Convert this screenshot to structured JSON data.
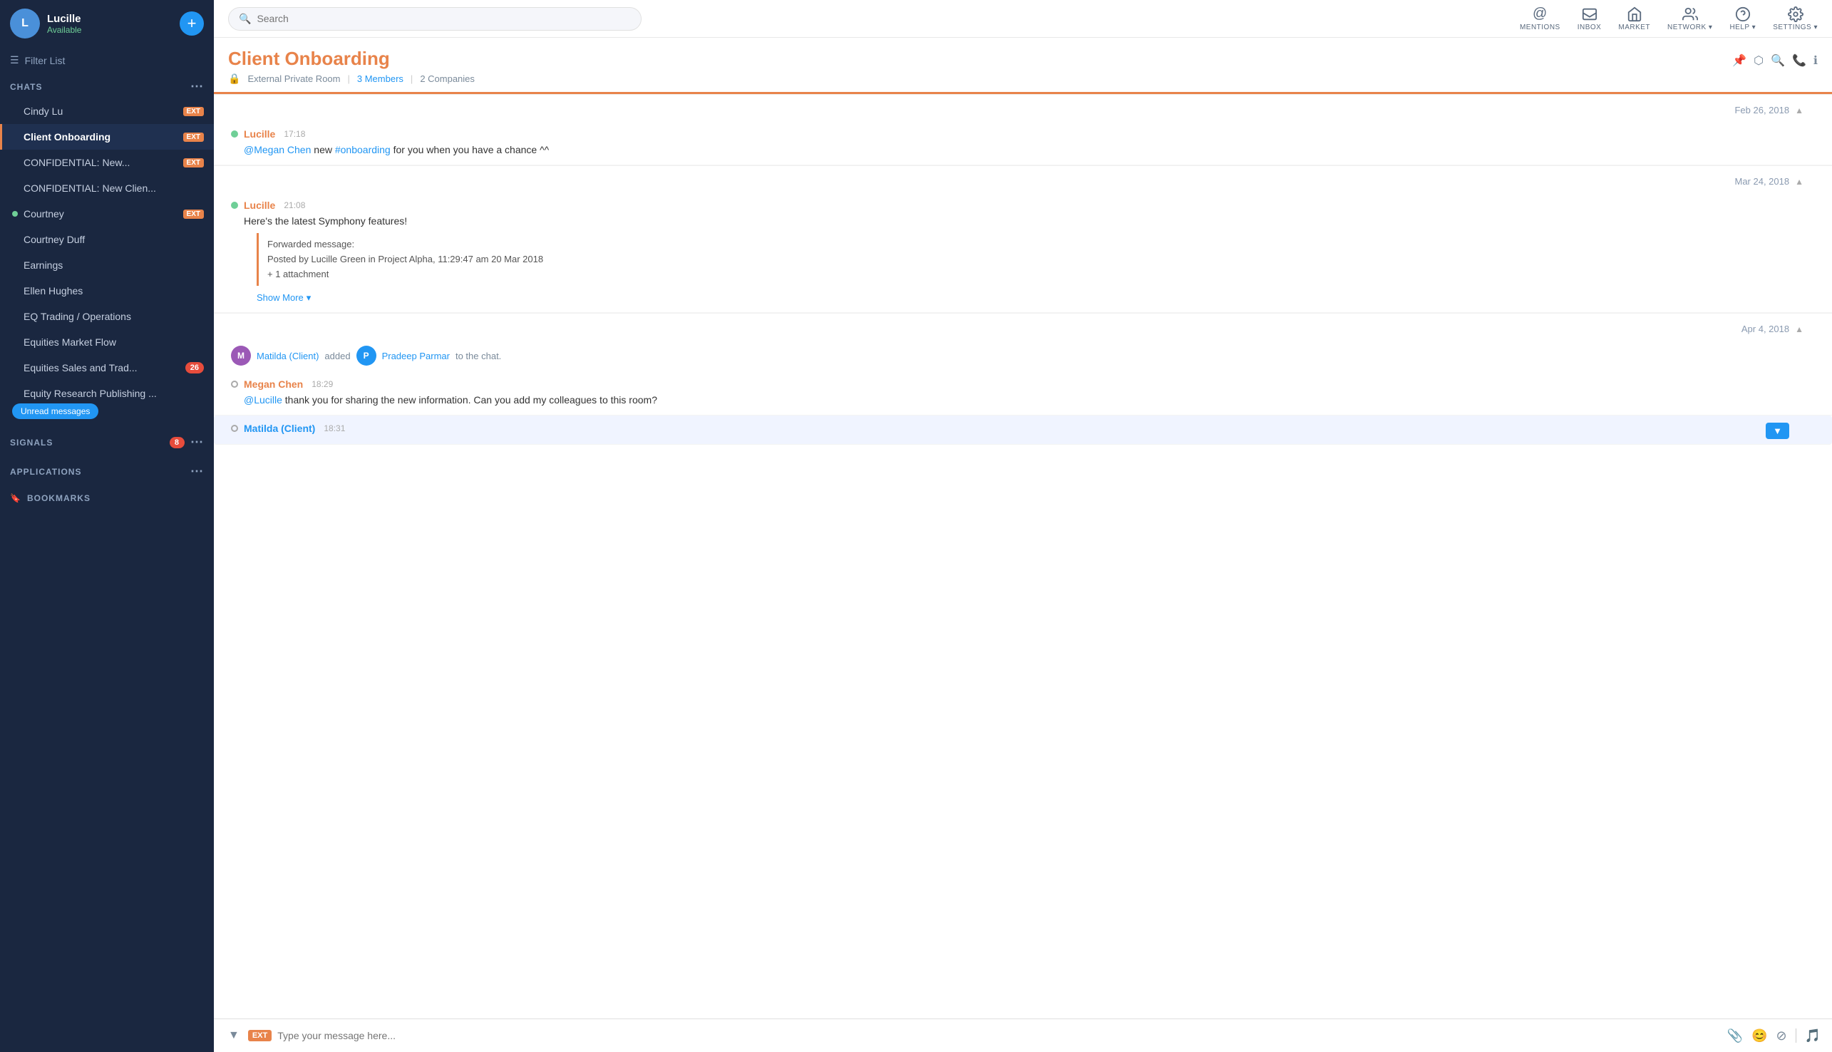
{
  "sidebar": {
    "user": {
      "name": "Lucille",
      "status": "Available",
      "initials": "L"
    },
    "add_button": "+",
    "filter_label": "Filter List",
    "sections": {
      "chats_label": "CHATS",
      "signals_label": "SIGNALS",
      "signals_badge": "8",
      "applications_label": "APPLICATIONS",
      "bookmarks_label": "BOOKMARKS"
    },
    "chats": [
      {
        "name": "Cindy Lu",
        "ext": true,
        "active": false,
        "status": "none",
        "unread": false
      },
      {
        "name": "Client Onboarding",
        "ext": true,
        "active": true,
        "status": "none",
        "unread": false
      },
      {
        "name": "CONFIDENTIAL: New...",
        "ext": true,
        "active": false,
        "status": "none",
        "unread": false
      },
      {
        "name": "CONFIDENTIAL: New Clien...",
        "ext": false,
        "active": false,
        "status": "none",
        "unread": false
      },
      {
        "name": "Courtney",
        "ext": true,
        "active": false,
        "status": "online",
        "unread": false
      },
      {
        "name": "Courtney Duff",
        "ext": false,
        "active": false,
        "status": "none",
        "unread": false
      },
      {
        "name": "Earnings",
        "ext": false,
        "active": false,
        "status": "none",
        "unread": false
      },
      {
        "name": "Ellen Hughes",
        "ext": false,
        "active": false,
        "status": "none",
        "unread": false
      },
      {
        "name": "EQ Trading / Operations",
        "ext": false,
        "active": false,
        "status": "none",
        "unread": false
      },
      {
        "name": "Equities Market Flow",
        "ext": false,
        "active": false,
        "status": "none",
        "unread": false
      },
      {
        "name": "Equities Sales and Trad...",
        "ext": false,
        "active": false,
        "status": "none",
        "badge": "26",
        "unread": false
      },
      {
        "name": "Equity Research Publishing ...",
        "ext": false,
        "active": false,
        "status": "none",
        "unread": true,
        "unread_label": "Unread messages"
      }
    ]
  },
  "topnav": {
    "search_placeholder": "Search",
    "icons": [
      {
        "id": "mentions",
        "label": "MENTIONS",
        "symbol": "@"
      },
      {
        "id": "inbox",
        "label": "INBOX",
        "symbol": "📥"
      },
      {
        "id": "market",
        "label": "MARKET",
        "symbol": "🏠"
      },
      {
        "id": "network",
        "label": "NETWORK ▾",
        "symbol": "👥"
      },
      {
        "id": "help",
        "label": "HELP ▾",
        "symbol": "?"
      },
      {
        "id": "settings",
        "label": "SETTINGS ▾",
        "symbol": "⚙"
      }
    ],
    "header_actions": [
      {
        "id": "pin",
        "symbol": "📌"
      },
      {
        "id": "popup",
        "symbol": "⬡"
      }
    ],
    "chat_actions": [
      {
        "id": "search-chat",
        "symbol": "🔍"
      },
      {
        "id": "call",
        "symbol": "📞"
      },
      {
        "id": "info",
        "symbol": "ℹ"
      }
    ]
  },
  "chat": {
    "title": "Client Onboarding",
    "room_type": "External Private Room",
    "members_label": "3 Members",
    "companies_label": "2 Companies",
    "messages": [
      {
        "id": "msg1",
        "date": "Feb 26, 2018",
        "sender": "Lucille",
        "sender_color": "orange",
        "time": "17:18",
        "status": "online",
        "text_parts": [
          {
            "type": "mention",
            "text": "@Megan Chen"
          },
          {
            "type": "text",
            "text": " new "
          },
          {
            "type": "hashtag",
            "text": "#onboarding"
          },
          {
            "type": "text",
            "text": " for you when you have a chance ^^"
          }
        ]
      },
      {
        "id": "msg2",
        "date": "Mar 24, 2018",
        "sender": "Lucille",
        "sender_color": "orange",
        "time": "21:08",
        "status": "online",
        "text": "Here's the latest Symphony features!",
        "forwarded": {
          "label": "Forwarded message:",
          "posted_by": "Posted by Lucille Green in Project Alpha, 11:29:47 am 20 Mar 2018",
          "attachment": "+ 1 attachment",
          "show_more": "Show More"
        }
      },
      {
        "id": "msg3",
        "date": "Apr 4, 2018",
        "system": true,
        "system_text_parts": [
          {
            "type": "link",
            "text": "Matilda (Client)"
          },
          {
            "type": "text",
            "text": " added "
          },
          {
            "type": "link",
            "text": "Pradeep Parmar"
          },
          {
            "type": "text",
            "text": " to the chat."
          }
        ],
        "matilda_avatar": "M",
        "pradeep_avatar": "P"
      },
      {
        "id": "msg4",
        "sender": "Megan Chen",
        "sender_color": "orange",
        "time": "18:29",
        "status": "offline",
        "text_parts": [
          {
            "type": "mention",
            "text": "@Lucille"
          },
          {
            "type": "text",
            "text": " thank you for sharing the new information. Can you add my colleagues to this room?"
          }
        ]
      },
      {
        "id": "msg5",
        "sender": "Matilda (Client)",
        "sender_color": "blue",
        "time": "18:31",
        "status": "offline",
        "has_dropdown": true
      }
    ]
  },
  "input": {
    "placeholder": "Type your message here...",
    "ext_label": "EXT",
    "icons": {
      "attachment": "📎",
      "emoji": "😊",
      "clear": "⊘",
      "music": "🎵"
    }
  }
}
